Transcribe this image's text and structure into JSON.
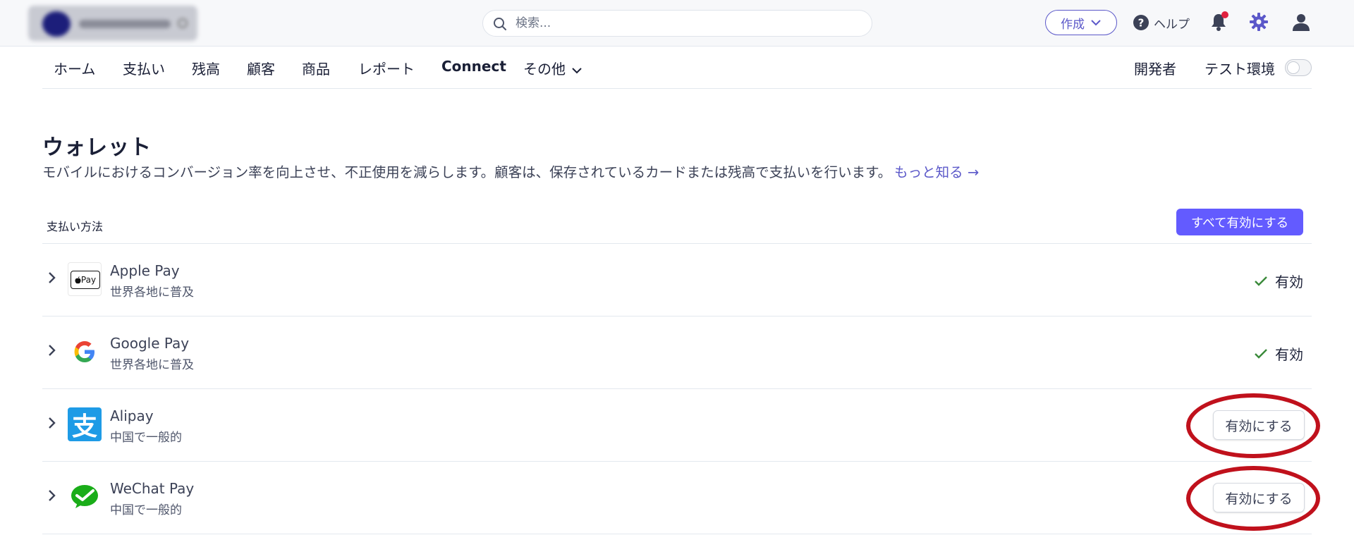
{
  "topbar": {
    "search_placeholder": "検索...",
    "create_label": "作成",
    "help_label": "ヘルプ"
  },
  "nav": {
    "tabs": [
      "ホーム",
      "支払い",
      "残高",
      "顧客",
      "商品",
      "レポート",
      "Connect",
      "その他"
    ],
    "developer": "開発者",
    "test_env": "テスト環境"
  },
  "page": {
    "title": "ウォレット",
    "description": "モバイルにおけるコンバージョン率を向上させ、不正使用を減らします。顧客は、保存されているカードまたは残高で支払いを行います。",
    "learn_more": "もっと知る →",
    "column_header": "支払い方法",
    "enable_all": "すべて有効にする"
  },
  "methods": [
    {
      "name": "Apple Pay",
      "sub": "世界各地に普及",
      "status": "有効",
      "enabled": true,
      "logo": "apple-pay-icon"
    },
    {
      "name": "Google Pay",
      "sub": "世界各地に普及",
      "status": "有効",
      "enabled": true,
      "logo": "google-icon"
    },
    {
      "name": "Alipay",
      "sub": "中国で一般的",
      "button": "有効にする",
      "enabled": false,
      "logo": "alipay-icon"
    },
    {
      "name": "WeChat Pay",
      "sub": "中国で一般的",
      "button": "有効にする",
      "enabled": false,
      "logo": "wechat-icon"
    }
  ],
  "logos": {
    "apple_pay_text": "Pay",
    "alipay_glyph": "支"
  },
  "colors": {
    "accent": "#635bff",
    "link": "#5b58c9",
    "check": "#3a8a3a",
    "annotation": "#c0111c",
    "alipay": "#1e9be6",
    "wechat": "#1aad19"
  }
}
